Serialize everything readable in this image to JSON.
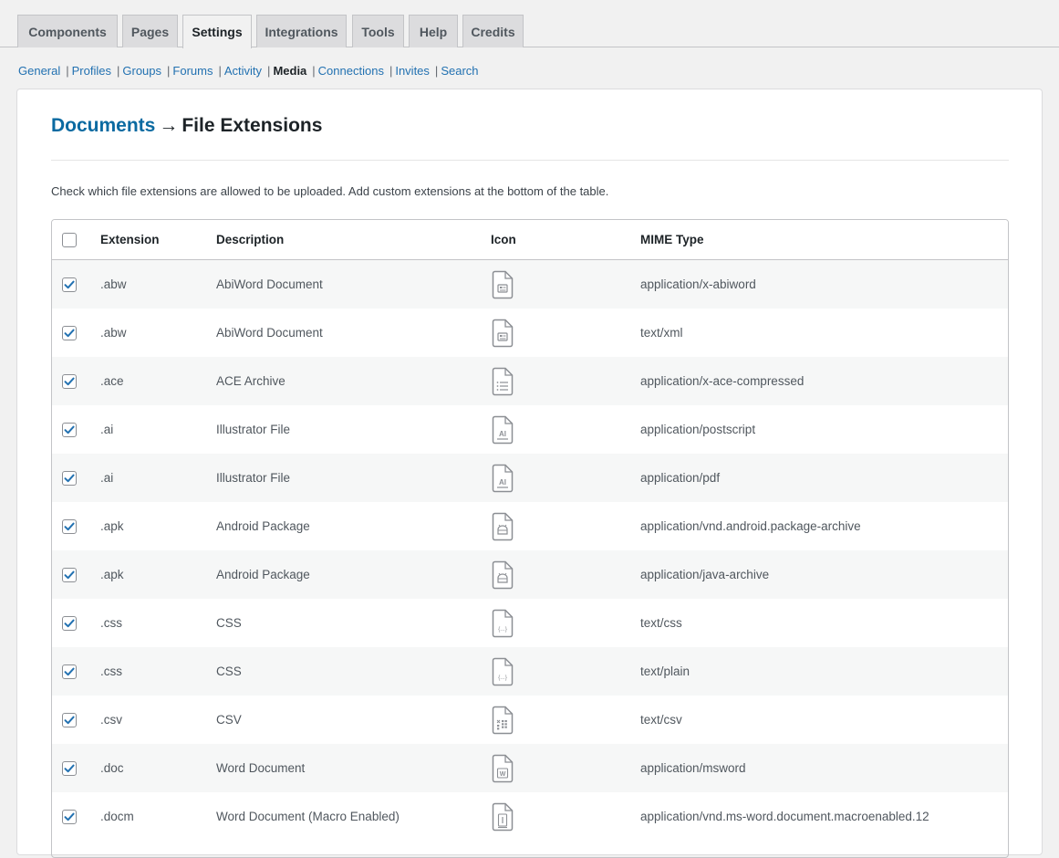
{
  "tabs": [
    "Components",
    "Pages",
    "Settings",
    "Integrations",
    "Tools",
    "Help",
    "Credits"
  ],
  "active_tab": "Settings",
  "subnav": [
    "General",
    "Profiles",
    "Groups",
    "Forums",
    "Activity",
    "Media",
    "Connections",
    "Invites",
    "Search"
  ],
  "subnav_current": "Media",
  "page": {
    "crumb": "Documents",
    "arrow": "→",
    "title": "File Extensions",
    "description": "Check which file extensions are allowed to be uploaded. Add custom extensions at the bottom of the table."
  },
  "table": {
    "headers": {
      "extension": "Extension",
      "description": "Description",
      "icon": "Icon",
      "mime": "MIME Type"
    },
    "select_all_checked": false,
    "rows": [
      {
        "checked": true,
        "ext": ".abw",
        "desc": "AbiWord Document",
        "icon": "abiword-file-icon",
        "mime": "application/x-abiword"
      },
      {
        "checked": true,
        "ext": ".abw",
        "desc": "AbiWord Document",
        "icon": "abiword-file-icon",
        "mime": "text/xml"
      },
      {
        "checked": true,
        "ext": ".ace",
        "desc": "ACE Archive",
        "icon": "archive-list-file-icon",
        "mime": "application/x-ace-compressed"
      },
      {
        "checked": true,
        "ext": ".ai",
        "desc": "Illustrator File",
        "icon": "illustrator-file-icon",
        "mime": "application/postscript"
      },
      {
        "checked": true,
        "ext": ".ai",
        "desc": "Illustrator File",
        "icon": "illustrator-file-icon",
        "mime": "application/pdf"
      },
      {
        "checked": true,
        "ext": ".apk",
        "desc": "Android Package",
        "icon": "android-file-icon",
        "mime": "application/vnd.android.package-archive"
      },
      {
        "checked": true,
        "ext": ".apk",
        "desc": "Android Package",
        "icon": "android-file-icon",
        "mime": "application/java-archive"
      },
      {
        "checked": true,
        "ext": ".css",
        "desc": "CSS",
        "icon": "code-file-icon",
        "mime": "text/css"
      },
      {
        "checked": true,
        "ext": ".css",
        "desc": "CSS",
        "icon": "code-file-icon",
        "mime": "text/plain"
      },
      {
        "checked": true,
        "ext": ".csv",
        "desc": "CSV",
        "icon": "spreadsheet-file-icon",
        "mime": "text/csv"
      },
      {
        "checked": true,
        "ext": ".doc",
        "desc": "Word Document",
        "icon": "word-file-icon",
        "mime": "application/msword"
      },
      {
        "checked": true,
        "ext": ".docm",
        "desc": "Word Document (Macro Enabled)",
        "icon": "word-macro-file-icon",
        "mime": "application/vnd.ms-word.document.macroenabled.12"
      }
    ]
  },
  "colors": {
    "link": "#2271b1",
    "crumb": "#0a6aa1",
    "check": "#2271b1",
    "icon_stroke": "#8c8f94"
  },
  "icon_labels": {
    "illustrator": "AI",
    "code": "{...}",
    "word": "W"
  }
}
